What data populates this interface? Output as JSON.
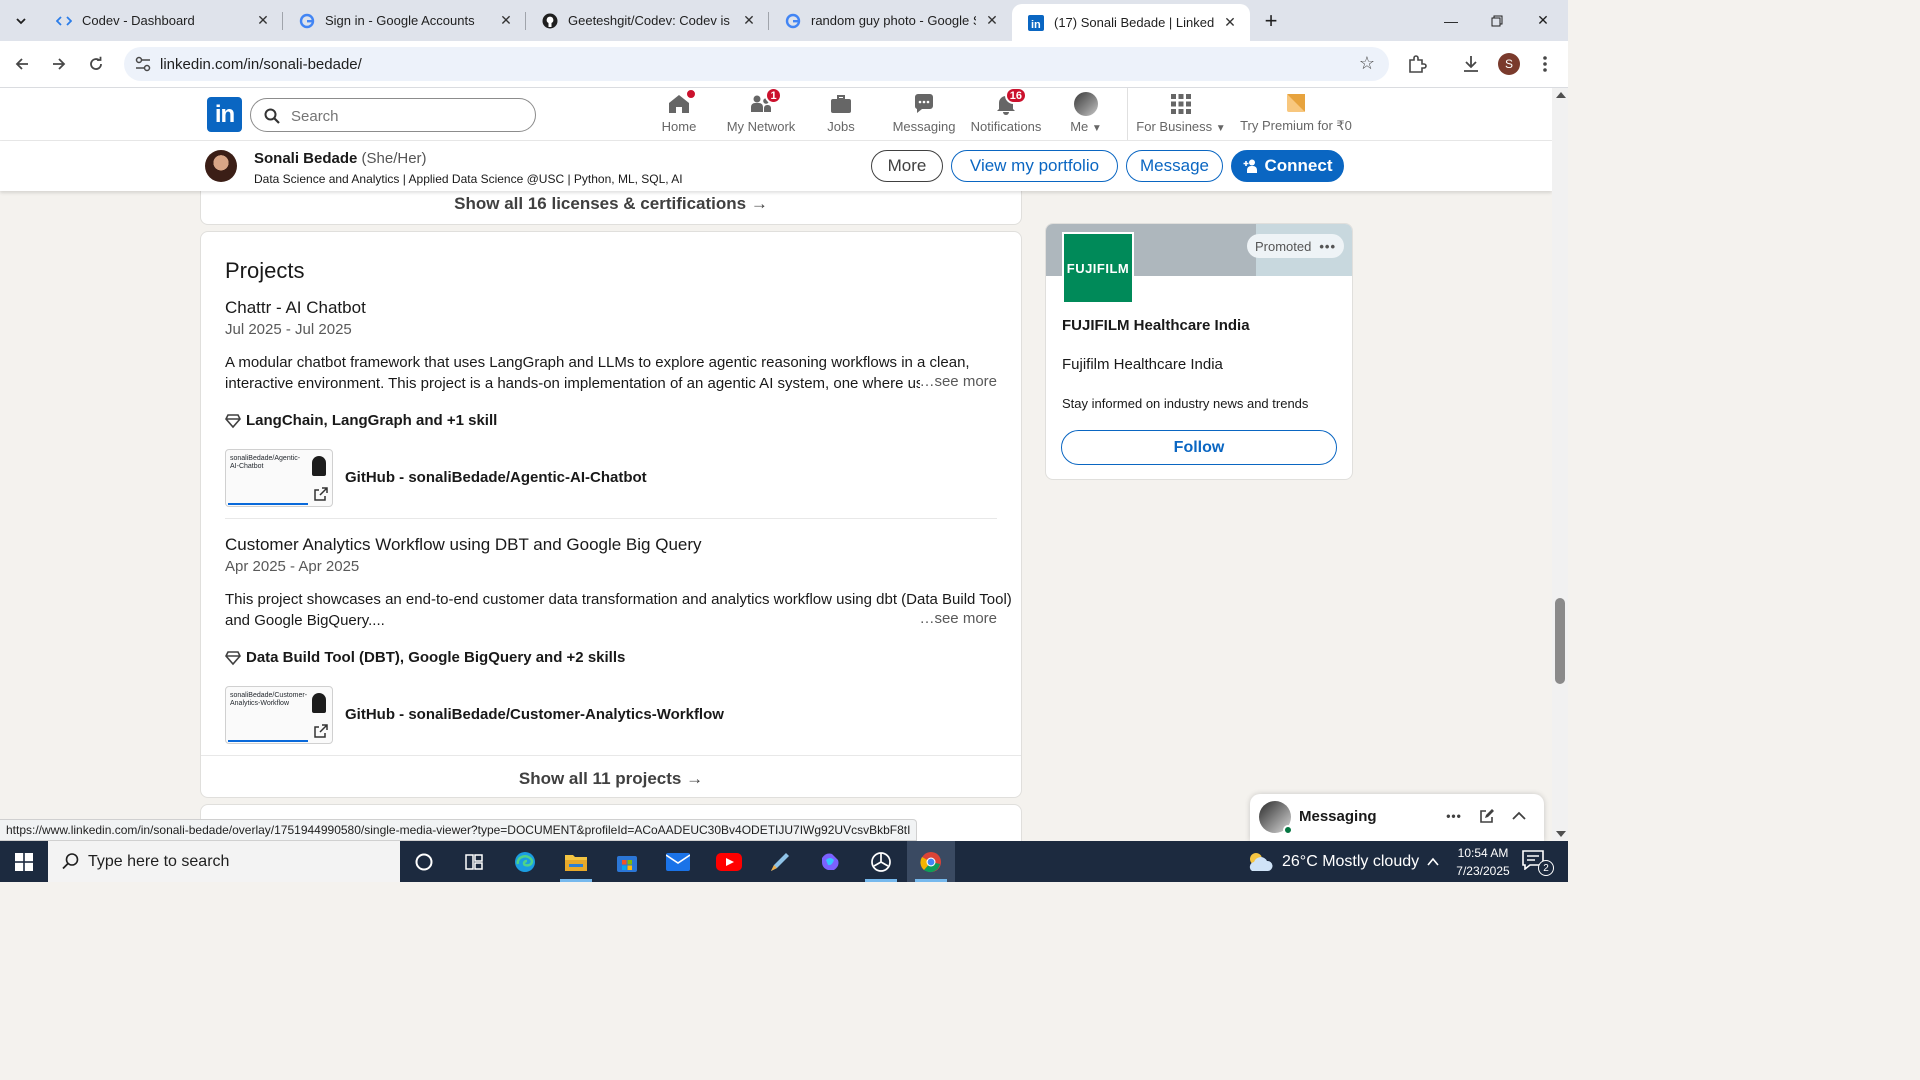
{
  "browser": {
    "tabs": [
      {
        "title": "Codev - Dashboard",
        "favicon": "code-icon",
        "active": false
      },
      {
        "title": "Sign in - Google Accounts",
        "favicon": "google-icon",
        "active": false
      },
      {
        "title": "Geeteshgit/Codev: Codev is a d",
        "favicon": "github-icon",
        "active": false
      },
      {
        "title": "random guy photo - Google Se",
        "favicon": "google-icon",
        "active": false
      },
      {
        "title": "(17) Sonali Bedade | LinkedIn",
        "favicon": "linkedin-icon",
        "active": true
      }
    ],
    "url": "linkedin.com/in/sonali-bedade/",
    "profile_initial": "S",
    "status_url": "https://www.linkedin.com/in/sonali-bedade/overlay/1751944990580/single-media-viewer?type=DOCUMENT&profileId=ACoAADEUC30Bv4ODETIJU7IWg92UVcsvBkbF8tI"
  },
  "linkedin_nav": {
    "logo": "in",
    "search_placeholder": "Search",
    "items": [
      {
        "label": "Home",
        "icon": "home-icon",
        "badge": "dot"
      },
      {
        "label": "My Network",
        "icon": "network-icon",
        "badge": "1"
      },
      {
        "label": "Jobs",
        "icon": "briefcase-icon",
        "badge": ""
      },
      {
        "label": "Messaging",
        "icon": "chat-icon",
        "badge": ""
      },
      {
        "label": "Notifications",
        "icon": "bell-icon",
        "badge": "16"
      },
      {
        "label": "Me",
        "icon": "avatar",
        "badge": ""
      }
    ],
    "for_business": "For Business",
    "premium": "Try Premium for ₹0"
  },
  "profile_bar": {
    "name": "Sonali Bedade",
    "pronouns": "(She/Her)",
    "headline": "Data Science and Analytics | Applied Data Science @USC | Python, ML, SQL, AI",
    "buttons": {
      "more": "More",
      "portfolio": "View my portfolio",
      "message": "Message",
      "connect": "Connect"
    }
  },
  "licenses": {
    "show_all": "Show all 16 licenses & certifications →"
  },
  "projects": {
    "heading": "Projects",
    "items": [
      {
        "title": "Chattr - AI Chatbot",
        "dates": "Jul 2025 - Jul 2025",
        "desc_line1": "A modular chatbot framework that uses LangGraph and LLMs to explore agentic reasoning workflows in a clean,",
        "desc_line2": "interactive environment. This project is a hands-on implementation of an agentic AI system, one where user inp",
        "see_more": "…see more",
        "skills": "LangChain, LangGraph and +1 skill",
        "media_thumb_text": "sonaliBedade/Agentic-AI-Chatbot",
        "media_title": "GitHub - sonaliBedade/Agentic-AI-Chatbot"
      },
      {
        "title": "Customer Analytics Workflow using DBT and Google Big Query",
        "dates": "Apr 2025 - Apr 2025",
        "desc_line1": "This project showcases an end-to-end customer data transformation and analytics workflow using dbt (Data Build Tool)",
        "desc_line2": "and Google BigQuery....",
        "see_more": "…see more",
        "skills": "Data Build Tool (DBT), Google BigQuery and +2 skills",
        "media_thumb_text": "sonaliBedade/Customer-Analytics-Workflow",
        "media_title": "GitHub - sonaliBedade/Customer-Analytics-Workflow"
      }
    ],
    "show_all": "Show all 11 projects →"
  },
  "ad": {
    "promoted": "Promoted",
    "logo_text": "FUJIFILM",
    "company": "FUJIFILM Healthcare India",
    "subtitle": "Fujifilm Healthcare India",
    "description": "Stay informed on industry news and trends",
    "follow": "Follow"
  },
  "messaging": {
    "label": "Messaging"
  },
  "taskbar": {
    "search_placeholder": "Type here to search",
    "weather": "26°C  Mostly cloudy",
    "time": "10:54 AM",
    "date": "7/23/2025",
    "notification_count": "2",
    "apps": [
      "cortana-icon",
      "task-view-icon",
      "edge-icon",
      "file-explorer-icon",
      "store-icon",
      "mail-icon",
      "youtube-icon",
      "paint-icon",
      "copilot-icon",
      "chatgpt-icon",
      "chrome-icon"
    ]
  },
  "colors": {
    "linkedin_blue": "#0a66c2",
    "badge_red": "#cb112d",
    "fujifilm_green": "#008a59",
    "taskbar": "#1c2a3f"
  }
}
